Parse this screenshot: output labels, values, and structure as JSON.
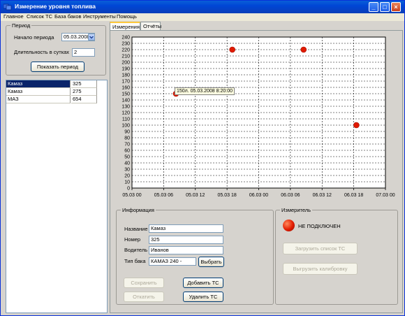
{
  "window": {
    "title": "Измерение уровня топлива"
  },
  "titlebar_buttons": {
    "minimize": "_",
    "maximize": "□",
    "close": "×"
  },
  "menu": [
    "Главное",
    "Список ТС",
    "База баков",
    "Инструменты",
    "Помощь"
  ],
  "period": {
    "title": "Период",
    "start_label": "Начало периода",
    "start_value": "05.03.2008",
    "duration_label": "Длительность в сутках",
    "duration_value": "2",
    "show_button": "Показать период"
  },
  "vehicles": [
    {
      "name": "Камаз",
      "value": "325",
      "selected": true
    },
    {
      "name": "Камаз",
      "value": "275",
      "selected": false
    },
    {
      "name": "МАЗ",
      "value": "654",
      "selected": false
    }
  ],
  "tabs": [
    {
      "label": "Измерения",
      "active": true
    },
    {
      "label": "Отчёты",
      "active": false
    }
  ],
  "chart_data": {
    "type": "scatter",
    "x_tick_labels": [
      "05.03 00",
      "05.03 06",
      "05.03 12",
      "05.03 18",
      "06.03 00",
      "06.03 06",
      "06.03 12",
      "06.03 18",
      "07.03 00"
    ],
    "y_tick_labels": [
      "0",
      "10",
      "20",
      "30",
      "40",
      "50",
      "60",
      "70",
      "80",
      "90",
      "100",
      "110",
      "120",
      "130",
      "140",
      "150",
      "160",
      "170",
      "180",
      "190",
      "200",
      "210",
      "220",
      "230",
      "240"
    ],
    "xlim": [
      "05.03.2008 00:00",
      "07.03.2008 00:00"
    ],
    "ylim": [
      0,
      240
    ],
    "points": [
      {
        "x": "05.03.2008 08:20",
        "y": 150
      },
      {
        "x": "05.03.2008 19:00",
        "y": 220
      },
      {
        "x": "06.03.2008 08:30",
        "y": 220
      },
      {
        "x": "06.03.2008 18:30",
        "y": 100
      }
    ],
    "grid": true,
    "point_color": "#e01a00",
    "tooltip": "150л. 05.03.2008 8:20:00"
  },
  "info": {
    "title": "Информация",
    "name_label": "Название",
    "name_value": "Камаз",
    "number_label": "Номер",
    "number_value": "325",
    "driver_label": "Водитель",
    "driver_value": "Иванов",
    "tank_label": "Тип бака",
    "tank_value": "КАМАЗ 240 -",
    "choose_button": "Выбрать",
    "save_button": "Сохранить",
    "cancel_button": "Откатить",
    "add_button": "Добавить ТС",
    "delete_button": "Удалить ТС"
  },
  "meter": {
    "title": "Измеритель",
    "status": "НЕ ПОДКЛЮЧЕН",
    "load_button": "Загрузить список ТС",
    "unload_button": "Выгрузить калибровку"
  }
}
